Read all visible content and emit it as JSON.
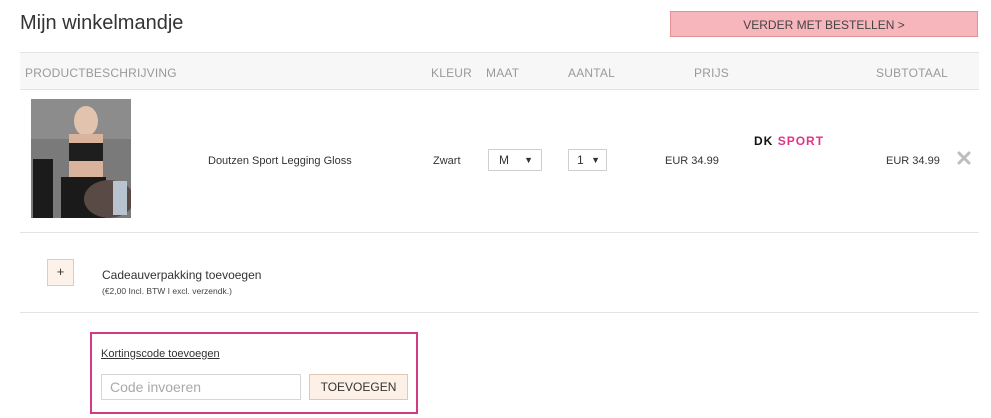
{
  "page": {
    "title": "Mijn winkelmandje"
  },
  "checkout": {
    "label": "VERDER MET BESTELLEN >"
  },
  "table": {
    "headers": {
      "description": "PRODUCTBESCHRIJVING",
      "color": "KLEUR",
      "size": "MAAT",
      "quantity": "AANTAL",
      "price": "PRIJS",
      "subtotal": "SUBTOTAAL"
    },
    "rows": [
      {
        "name": "Doutzen Sport Legging Gloss",
        "color": "Zwart",
        "size": "M",
        "quantity": "1",
        "price": "EUR 34.99",
        "brand_part1": "DK",
        "brand_part2": "SPORT",
        "subtotal": "EUR 34.99",
        "image_icon": "product-photo-icon",
        "remove_icon": "close-icon"
      }
    ]
  },
  "gift": {
    "button_label": "+",
    "title": "Cadeauverpakking toevoegen",
    "note": "(€2,00 Incl. BTW I excl. verzendk.)"
  },
  "coupon": {
    "link_label": "Kortingscode toevoegen",
    "placeholder": "Code invoeren",
    "button_label": "TOEVOEGEN"
  },
  "colors": {
    "checkout_bg": "#f7b6bb",
    "coupon_border": "#d43983",
    "brand_accent": "#e0338a"
  }
}
